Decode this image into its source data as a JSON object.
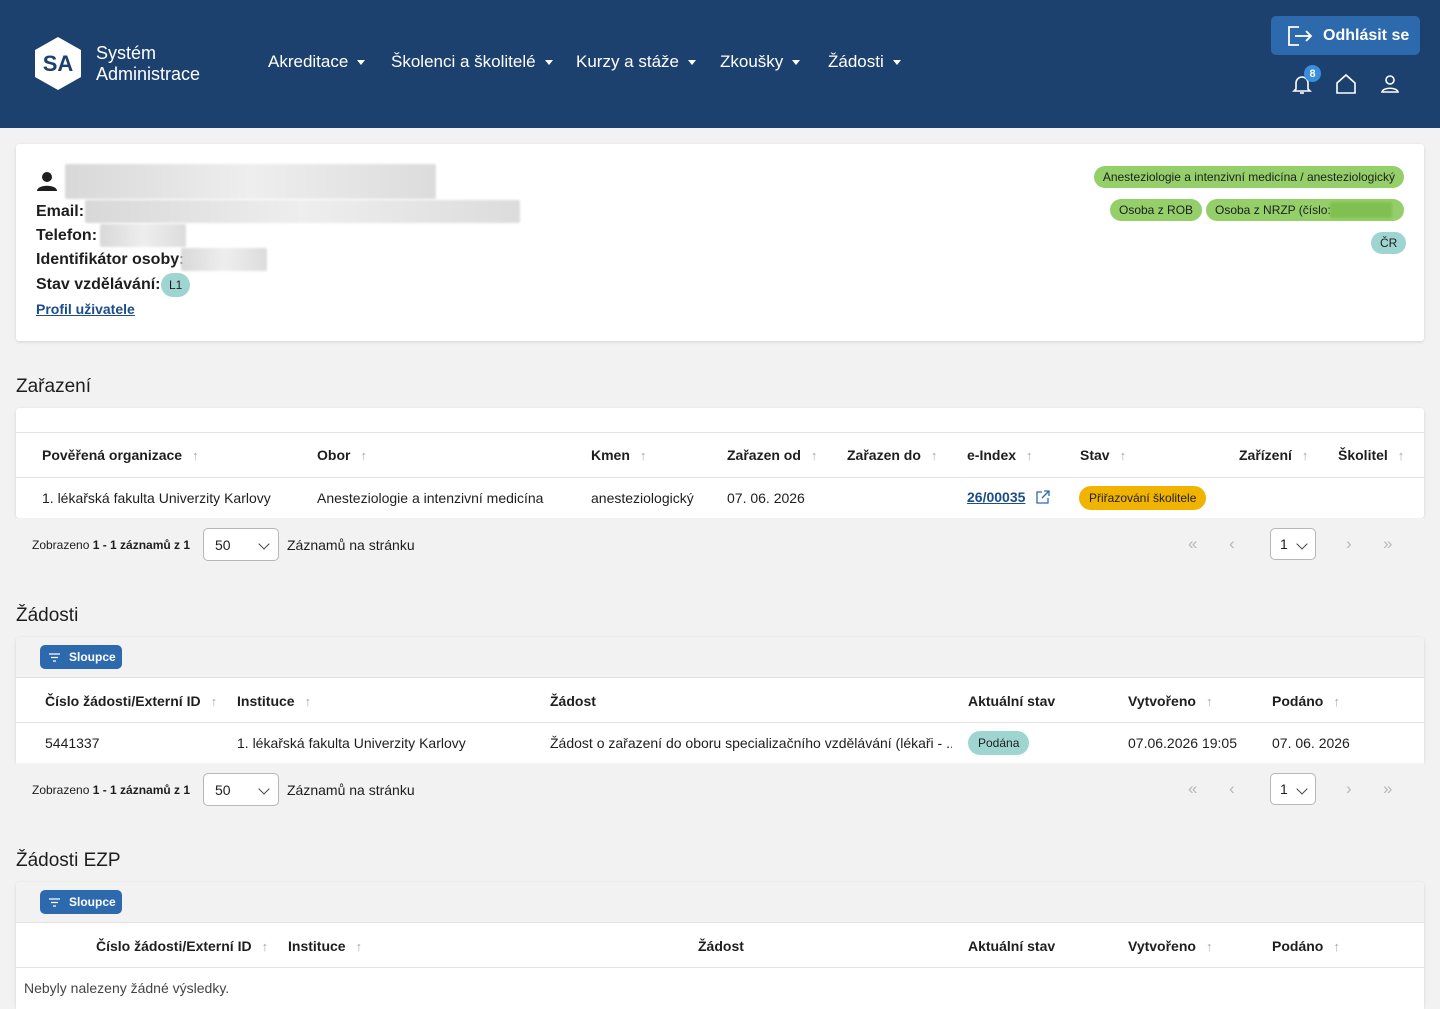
{
  "header": {
    "logo_text": "SA",
    "brand_line1": "Systém",
    "brand_line2": "Administrace",
    "nav": [
      {
        "label": "Akreditace"
      },
      {
        "label": "Školenci a školitelé"
      },
      {
        "label": "Kurzy a stáže"
      },
      {
        "label": "Zkoušky"
      },
      {
        "label": "Žádosti"
      }
    ],
    "logout_label": "Odhlásit se",
    "notification_count": "8",
    "icons": [
      "bell-icon",
      "home-icon",
      "user-icon"
    ],
    "bg_color": "#1c416e",
    "accent": "#2d69ad"
  },
  "person": {
    "email_label": "Email:",
    "phone_label": "Telefon:",
    "id_label": "Identifikátor osoby:",
    "edu_label": "Stav vzdělávání:",
    "edu_value": "L1",
    "profile_link": "Profil uživatele",
    "tags": {
      "field": "Anesteziologie a intenzivní medicína / anesteziologický",
      "rob": "Osoba z ROB",
      "nrzp": "Osoba z NRZP (číslo:",
      "country": "ČR"
    }
  },
  "zarazeni": {
    "title": "Zařazení",
    "headers": [
      "Pověřená organizace",
      "Obor",
      "Kmen",
      "Zařazen od",
      "Zařazen do",
      "e-Index",
      "Stav",
      "Zařízení",
      "Školitel"
    ],
    "row": {
      "org": "1. lékařská fakulta Univerzity Karlovy",
      "obor": "Anesteziologie a intenzivní medicína",
      "kmen": "anesteziologický",
      "od": "07. 06. 2026",
      "do": "",
      "eindex": "26/00035",
      "stav": "Přiřazování školitele",
      "zarizeni": "",
      "skolitel": ""
    },
    "pager": {
      "shown_prefix": "Zobrazeno ",
      "shown_range": "1 - 1 záznamů z 1",
      "page_size": "50",
      "per_page_label": "Záznamů na stránku",
      "page": "1"
    }
  },
  "zadosti": {
    "title": "Žádosti",
    "columns_button": "Sloupce",
    "headers": [
      "Číslo žádosti/Externí ID",
      "Instituce",
      "Žádost",
      "Aktuální stav",
      "Vytvořeno",
      "Podáno"
    ],
    "row": {
      "cislo": "5441337",
      "instituce": "1. lékařská fakulta Univerzity Karlovy",
      "zadost": "Žádost o zařazení do oboru specializačního vzdělávání (lékaři - ...",
      "stav": "Podána",
      "vytvoreno": "07.06.2026 19:05",
      "podano": "07. 06. 2026"
    },
    "pager": {
      "shown_prefix": "Zobrazeno ",
      "shown_range": "1 - 1 záznamů z 1",
      "page_size": "50",
      "per_page_label": "Záznamů na stránku",
      "page": "1"
    }
  },
  "zadosti_ezp": {
    "title": "Žádosti EZP",
    "columns_button": "Sloupce",
    "headers": [
      "Číslo žádosti/Externí ID",
      "Instituce",
      "Žádost",
      "Aktuální stav",
      "Vytvořeno",
      "Podáno"
    ],
    "empty": "Nebyly nalezeny žádné výsledky."
  },
  "colors": {
    "status_orange": "#f0b400",
    "status_teal": "#9fd5d1",
    "tag_green": "#95cf6a"
  }
}
